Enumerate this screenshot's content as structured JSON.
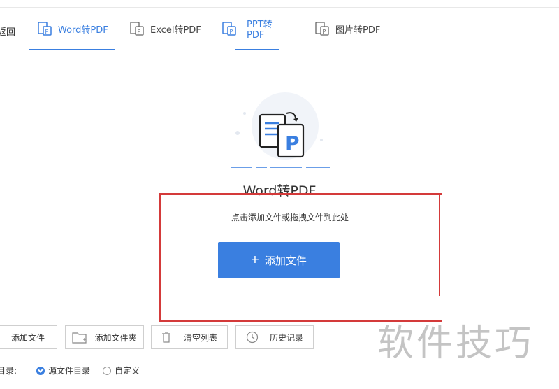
{
  "header": {
    "back_label": "返回",
    "tabs": [
      {
        "label": "Word转PDF",
        "icon": "word-to-pdf-icon",
        "active": true
      },
      {
        "label": "Excel转PDF",
        "icon": "excel-to-pdf-icon",
        "active": false
      },
      {
        "label": "PPT转PDF",
        "icon": "ppt-to-pdf-icon",
        "active": true
      },
      {
        "label": "图片转PDF",
        "icon": "image-to-pdf-icon",
        "active": false
      }
    ]
  },
  "main": {
    "title": "Word转PDF",
    "hint": "点击添加文件或拖拽文件到此处",
    "add_button": "添加文件",
    "hero_icon": "word-convert-pdf-icon"
  },
  "toolbar": {
    "add_file": "添加文件",
    "add_folder": "添加文件夹",
    "clear_list": "清空列表",
    "history": "历史记录"
  },
  "output": {
    "label": "目录:",
    "options": [
      {
        "label": "源文件目录",
        "selected": true
      },
      {
        "label": "自定义",
        "selected": false
      }
    ]
  },
  "watermark": "软件技巧",
  "colors": {
    "accent": "#3a7fe0",
    "annotation": "#d43a3a"
  }
}
